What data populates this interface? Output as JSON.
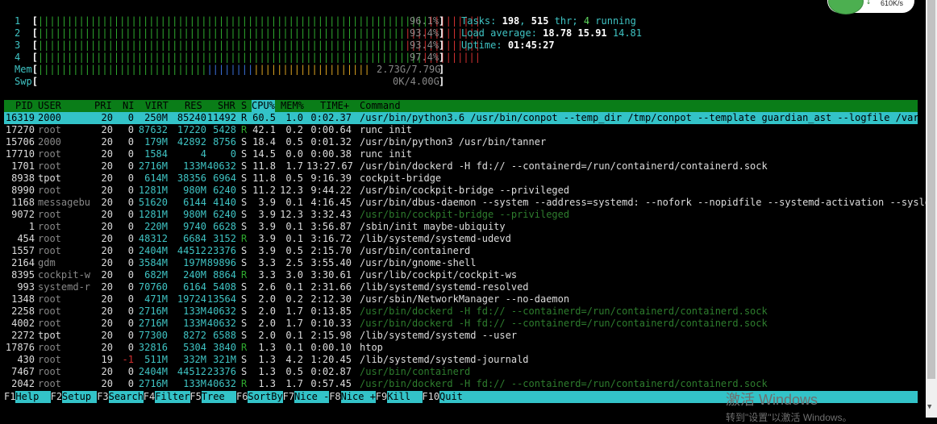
{
  "meters": {
    "cpu": [
      {
        "label": "1",
        "green": "|||||||||||||||||||||||||||||||||||||||||||||||||||||||||||||||||||",
        "red": "|||||||||",
        "pct": "96.1%",
        "value": 0.961
      },
      {
        "label": "2",
        "green": "|||||||||||||||||||||||||||||||||||||||||||||||||||||||||||||||",
        "red": "|||||||||||||",
        "pct": "93.4%",
        "value": 0.934
      },
      {
        "label": "3",
        "green": "|||||||||||||||||||||||||||||||||||||||||||||||||||||||||||||||",
        "red": "|||||||||||||",
        "pct": "93.4%",
        "value": 0.934
      },
      {
        "label": "4",
        "green": "||||||||||||||||||||||||||||||||||||||||||||||||||||||||||||||||||",
        "red": "||||||||||",
        "pct": "97.4%",
        "value": 0.974
      }
    ],
    "mem": {
      "label": "Mem",
      "green": "|||||||||||||||||||||||||||||",
      "blue": "||||||||",
      "yellow": "||||||||||||||||||||",
      "value": "2.73G/7.79G"
    },
    "swp": {
      "label": "Swp",
      "value": "0K/4.00G"
    }
  },
  "summary": {
    "tasks_label": "Tasks:",
    "tasks": "198",
    "sep1": ",",
    "threads": "515",
    "thr_label": "thr;",
    "running": "4",
    "running_label": "running",
    "load_label": "Load average:",
    "load1": "18.78",
    "load5": "15.91",
    "load15": "14.81",
    "uptime_label": "Uptime:",
    "uptime": "01:45:27"
  },
  "header": {
    "pid": "PID",
    "user": "USER",
    "pri": "PRI",
    "ni": "NI",
    "virt": "VIRT",
    "res": "RES",
    "shr": "SHR",
    "s": "S",
    "cpu": "CPU%",
    "mem": "MEM%",
    "time": "TIME+",
    "command": "Command"
  },
  "processes": [
    {
      "pid": "16319",
      "user": "2000",
      "pri": "20",
      "ni": "0",
      "virt": "250M",
      "res": "85240",
      "shr": "11492",
      "s": "R",
      "cpu": "60.5",
      "mem": "1.0",
      "time": "0:02.37",
      "cmd": "/usr/bin/python3.6 /usr/bin/conpot --temp_dir /tmp/conpot --template guardian_ast --logfile /var/lo"
    },
    {
      "pid": "17270",
      "user": "root",
      "pri": "20",
      "ni": "0",
      "virt": "87632",
      "res": "17220",
      "shr": "5428",
      "s": "R",
      "cpu": "42.1",
      "mem": "0.2",
      "time": "0:00.64",
      "cmd": "runc init"
    },
    {
      "pid": "15706",
      "user": "2000",
      "pri": "20",
      "ni": "0",
      "virt": "179M",
      "res": "42892",
      "shr": "8756",
      "s": "S",
      "cpu": "18.4",
      "mem": "0.5",
      "time": "0:01.32",
      "cmd": "/usr/bin/python3 /usr/bin/tanner"
    },
    {
      "pid": "17710",
      "user": "root",
      "pri": "20",
      "ni": "0",
      "virt": "1584",
      "res": "4",
      "shr": "0",
      "s": "S",
      "cpu": "14.5",
      "mem": "0.0",
      "time": "0:00.38",
      "cmd": "runc init"
    },
    {
      "pid": "1701",
      "user": "root",
      "pri": "20",
      "ni": "0",
      "virt": "2716M",
      "res": "133M",
      "shr": "40632",
      "s": "S",
      "cpu": "11.8",
      "mem": "1.7",
      "time": "13:27.67",
      "cmd": "/usr/bin/dockerd -H fd:// --containerd=/run/containerd/containerd.sock"
    },
    {
      "pid": "8938",
      "user": "tpot",
      "pri": "20",
      "ni": "0",
      "virt": "614M",
      "res": "38356",
      "shr": "6964",
      "s": "S",
      "cpu": "11.8",
      "mem": "0.5",
      "time": "9:16.39",
      "cmd": "cockpit-bridge"
    },
    {
      "pid": "8990",
      "user": "root",
      "pri": "20",
      "ni": "0",
      "virt": "1281M",
      "res": "980M",
      "shr": "6240",
      "s": "S",
      "cpu": "11.2",
      "mem": "12.3",
      "time": "9:44.22",
      "cmd": "/usr/bin/cockpit-bridge --privileged"
    },
    {
      "pid": "1168",
      "user": "messagebu",
      "pri": "20",
      "ni": "0",
      "virt": "51620",
      "res": "6144",
      "shr": "4140",
      "s": "S",
      "cpu": "3.9",
      "mem": "0.1",
      "time": "4:16.45",
      "cmd": "/usr/bin/dbus-daemon --system --address=systemd: --nofork --nopidfile --systemd-activation --syslog"
    },
    {
      "pid": "9072",
      "user": "root",
      "pri": "20",
      "ni": "0",
      "virt": "1281M",
      "res": "980M",
      "shr": "6240",
      "s": "S",
      "cpu": "3.9",
      "mem": "12.3",
      "time": "3:32.43",
      "cmd": "/usr/bin/cockpit-bridge --privileged",
      "thread": true
    },
    {
      "pid": "1",
      "user": "root",
      "pri": "20",
      "ni": "0",
      "virt": "220M",
      "res": "9740",
      "shr": "6628",
      "s": "S",
      "cpu": "3.9",
      "mem": "0.1",
      "time": "3:56.87",
      "cmd": "/sbin/init maybe-ubiquity"
    },
    {
      "pid": "454",
      "user": "root",
      "pri": "20",
      "ni": "0",
      "virt": "48312",
      "res": "6684",
      "shr": "3152",
      "s": "R",
      "cpu": "3.9",
      "mem": "0.1",
      "time": "3:16.72",
      "cmd": "/lib/systemd/systemd-udevd"
    },
    {
      "pid": "1557",
      "user": "root",
      "pri": "20",
      "ni": "0",
      "virt": "2404M",
      "res": "44512",
      "shr": "23376",
      "s": "S",
      "cpu": "3.9",
      "mem": "0.5",
      "time": "2:15.70",
      "cmd": "/usr/bin/containerd"
    },
    {
      "pid": "2164",
      "user": "gdm",
      "pri": "20",
      "ni": "0",
      "virt": "3584M",
      "res": "197M",
      "shr": "89896",
      "s": "S",
      "cpu": "3.3",
      "mem": "2.5",
      "time": "3:55.40",
      "cmd": "/usr/bin/gnome-shell"
    },
    {
      "pid": "8395",
      "user": "cockpit-w",
      "pri": "20",
      "ni": "0",
      "virt": "682M",
      "res": "240M",
      "shr": "8864",
      "s": "R",
      "cpu": "3.3",
      "mem": "3.0",
      "time": "3:30.61",
      "cmd": "/usr/lib/cockpit/cockpit-ws"
    },
    {
      "pid": "993",
      "user": "systemd-r",
      "pri": "20",
      "ni": "0",
      "virt": "70760",
      "res": "6164",
      "shr": "5408",
      "s": "S",
      "cpu": "2.6",
      "mem": "0.1",
      "time": "2:31.66",
      "cmd": "/lib/systemd/systemd-resolved"
    },
    {
      "pid": "1348",
      "user": "root",
      "pri": "20",
      "ni": "0",
      "virt": "471M",
      "res": "19724",
      "shr": "13564",
      "s": "S",
      "cpu": "2.0",
      "mem": "0.2",
      "time": "2:12.30",
      "cmd": "/usr/sbin/NetworkManager --no-daemon"
    },
    {
      "pid": "2258",
      "user": "root",
      "pri": "20",
      "ni": "0",
      "virt": "2716M",
      "res": "133M",
      "shr": "40632",
      "s": "S",
      "cpu": "2.0",
      "mem": "1.7",
      "time": "0:13.85",
      "cmd": "/usr/bin/dockerd -H fd:// --containerd=/run/containerd/containerd.sock",
      "thread": true
    },
    {
      "pid": "4002",
      "user": "root",
      "pri": "20",
      "ni": "0",
      "virt": "2716M",
      "res": "133M",
      "shr": "40632",
      "s": "S",
      "cpu": "2.0",
      "mem": "1.7",
      "time": "0:10.33",
      "cmd": "/usr/bin/dockerd -H fd:// --containerd=/run/containerd/containerd.sock",
      "thread": true
    },
    {
      "pid": "2272",
      "user": "tpot",
      "pri": "20",
      "ni": "0",
      "virt": "77300",
      "res": "8272",
      "shr": "6588",
      "s": "S",
      "cpu": "2.0",
      "mem": "0.1",
      "time": "2:15.98",
      "cmd": "/lib/systemd/systemd --user"
    },
    {
      "pid": "17876",
      "user": "root",
      "pri": "20",
      "ni": "0",
      "virt": "32816",
      "res": "5304",
      "shr": "3840",
      "s": "R",
      "cpu": "1.3",
      "mem": "0.1",
      "time": "0:00.10",
      "cmd": "htop"
    },
    {
      "pid": "430",
      "user": "root",
      "pri": "19",
      "ni": "-1",
      "virt": "511M",
      "res": "332M",
      "shr": "321M",
      "s": "S",
      "cpu": "1.3",
      "mem": "4.2",
      "time": "1:20.45",
      "cmd": "/lib/systemd/systemd-journald"
    },
    {
      "pid": "7467",
      "user": "root",
      "pri": "20",
      "ni": "0",
      "virt": "2404M",
      "res": "44512",
      "shr": "23376",
      "s": "S",
      "cpu": "1.3",
      "mem": "0.5",
      "time": "0:02.87",
      "cmd": "/usr/bin/containerd",
      "thread": true
    },
    {
      "pid": "2042",
      "user": "root",
      "pri": "20",
      "ni": "0",
      "virt": "2716M",
      "res": "133M",
      "shr": "40632",
      "s": "R",
      "cpu": "1.3",
      "mem": "1.7",
      "time": "0:57.45",
      "cmd": "/usr/bin/dockerd -H fd:// --containerd=/run/containerd/containerd.sock",
      "thread": true
    }
  ],
  "fkeys": [
    {
      "key": "F1",
      "label": "Help  "
    },
    {
      "key": "F2",
      "label": "Setup "
    },
    {
      "key": "F3",
      "label": "Search"
    },
    {
      "key": "F4",
      "label": "Filter"
    },
    {
      "key": "F5",
      "label": "Tree  "
    },
    {
      "key": "F6",
      "label": "SortBy"
    },
    {
      "key": "F7",
      "label": "Nice -"
    },
    {
      "key": "F8",
      "label": "Nice +"
    },
    {
      "key": "F9",
      "label": "Kill  "
    },
    {
      "key": "F10",
      "label": "Quit"
    }
  ],
  "net_speed": "610K/s",
  "watermark": {
    "line1": "激活 Windows",
    "line2": "转到\"设置\"以激活 Windows。"
  },
  "colors": {
    "header_bg": "#0a7d18",
    "selected_bg": "#33c3c8",
    "cyan": "#3fc4c4",
    "green": "#2ea82e",
    "red": "#d03030"
  }
}
